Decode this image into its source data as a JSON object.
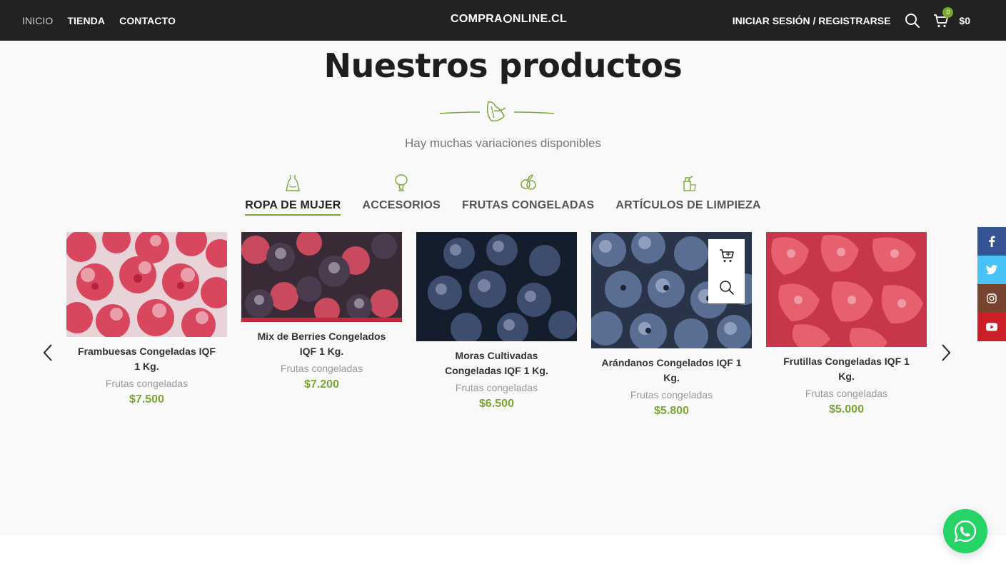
{
  "header": {
    "nav": [
      {
        "label": "INICIO"
      },
      {
        "label": "TIENDA"
      },
      {
        "label": "CONTACTO"
      }
    ],
    "logo_left": "COMPRA",
    "logo_right": "NLINE.CL",
    "login_label": "INICIAR SESIÓN / REGISTRARSE",
    "cart_count": "0",
    "cart_total": "$0"
  },
  "section": {
    "title": "Nuestros productos",
    "subtitle": "Hay muchas variaciones disponibles"
  },
  "tabs": [
    {
      "label": "ROPA DE MUJER",
      "icon": "dress-icon",
      "active": true
    },
    {
      "label": "ACCESORIOS",
      "icon": "mirror-icon",
      "active": false
    },
    {
      "label": "FRUTAS CONGELADAS",
      "icon": "fruit-icon",
      "active": false
    },
    {
      "label": "ARTÍCULOS DE LIMPIEZA",
      "icon": "cleaning-icon",
      "active": false
    }
  ],
  "products": [
    {
      "name": "Frambuesas Congeladas IQF 1 Kg.",
      "category": "Frutas congeladas",
      "price": "$7.500",
      "image": "frozen-raspberries-image"
    },
    {
      "name": "Mix de Berries Congelados IQF 1 Kg.",
      "category": "Frutas congeladas",
      "price": "$7.200",
      "image": "frozen-mixed-berries-image"
    },
    {
      "name": "Moras Cultivadas Congeladas IQF 1 Kg.",
      "category": "Frutas congeladas",
      "price": "$6.500",
      "image": "frozen-blackberries-image"
    },
    {
      "name": "Arándanos Congelados IQF 1 Kg.",
      "category": "Frutas congeladas",
      "price": "$5.800",
      "image": "frozen-blueberries-image"
    },
    {
      "name": "Frutillas Congeladas IQF 1 Kg.",
      "category": "Frutas congeladas",
      "price": "$5.000",
      "image": "frozen-strawberries-image"
    }
  ],
  "social": [
    "facebook-icon",
    "twitter-icon",
    "instagram-icon",
    "youtube-icon"
  ],
  "colors": {
    "header_bg": "#222222",
    "accent": "#7aa634",
    "facebook": "#365493",
    "twitter": "#49c3f6",
    "instagram": "#774430",
    "youtube": "#cb2027",
    "whatsapp": "#25d366"
  }
}
